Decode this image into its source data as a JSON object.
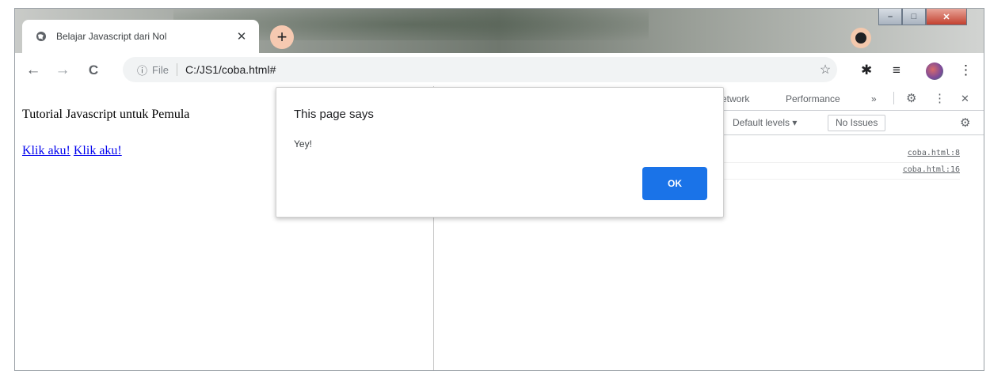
{
  "window": {
    "controls": {
      "minimize": "–",
      "maximize": "□",
      "close": "✕"
    }
  },
  "tabstrip": {
    "tab": {
      "title": "Belajar Javascript dari Nol",
      "close": "✕"
    },
    "new_tab": "+"
  },
  "toolbar": {
    "back": "←",
    "forward": "→",
    "reload": "C",
    "omnibox": {
      "info_icon": "ⓘ",
      "scheme_label": "File",
      "url": "C:/JS1/coba.html#"
    },
    "bookmark_star": "☆",
    "extensions_icon": "✱",
    "reading_list_icon": "≡",
    "menu_icon": "⋮"
  },
  "page": {
    "heading": "Tutorial Javascript untuk Pemula",
    "links": [
      "Klik aku!",
      "Klik aku!"
    ]
  },
  "devtools": {
    "tabs": [
      "etwork",
      "Performance"
    ],
    "more_tabs": "»",
    "settings_icon": "⚙",
    "kebab_icon": "⋮",
    "close_icon": "✕",
    "filter": {
      "levels": "Default levels ▾",
      "issues": "No Issues",
      "settings_icon": "⚙"
    },
    "console_links": [
      "coba.html:8",
      "coba.html:16"
    ]
  },
  "dialog": {
    "title": "This page says",
    "message": "Yey!",
    "ok_label": "OK"
  }
}
